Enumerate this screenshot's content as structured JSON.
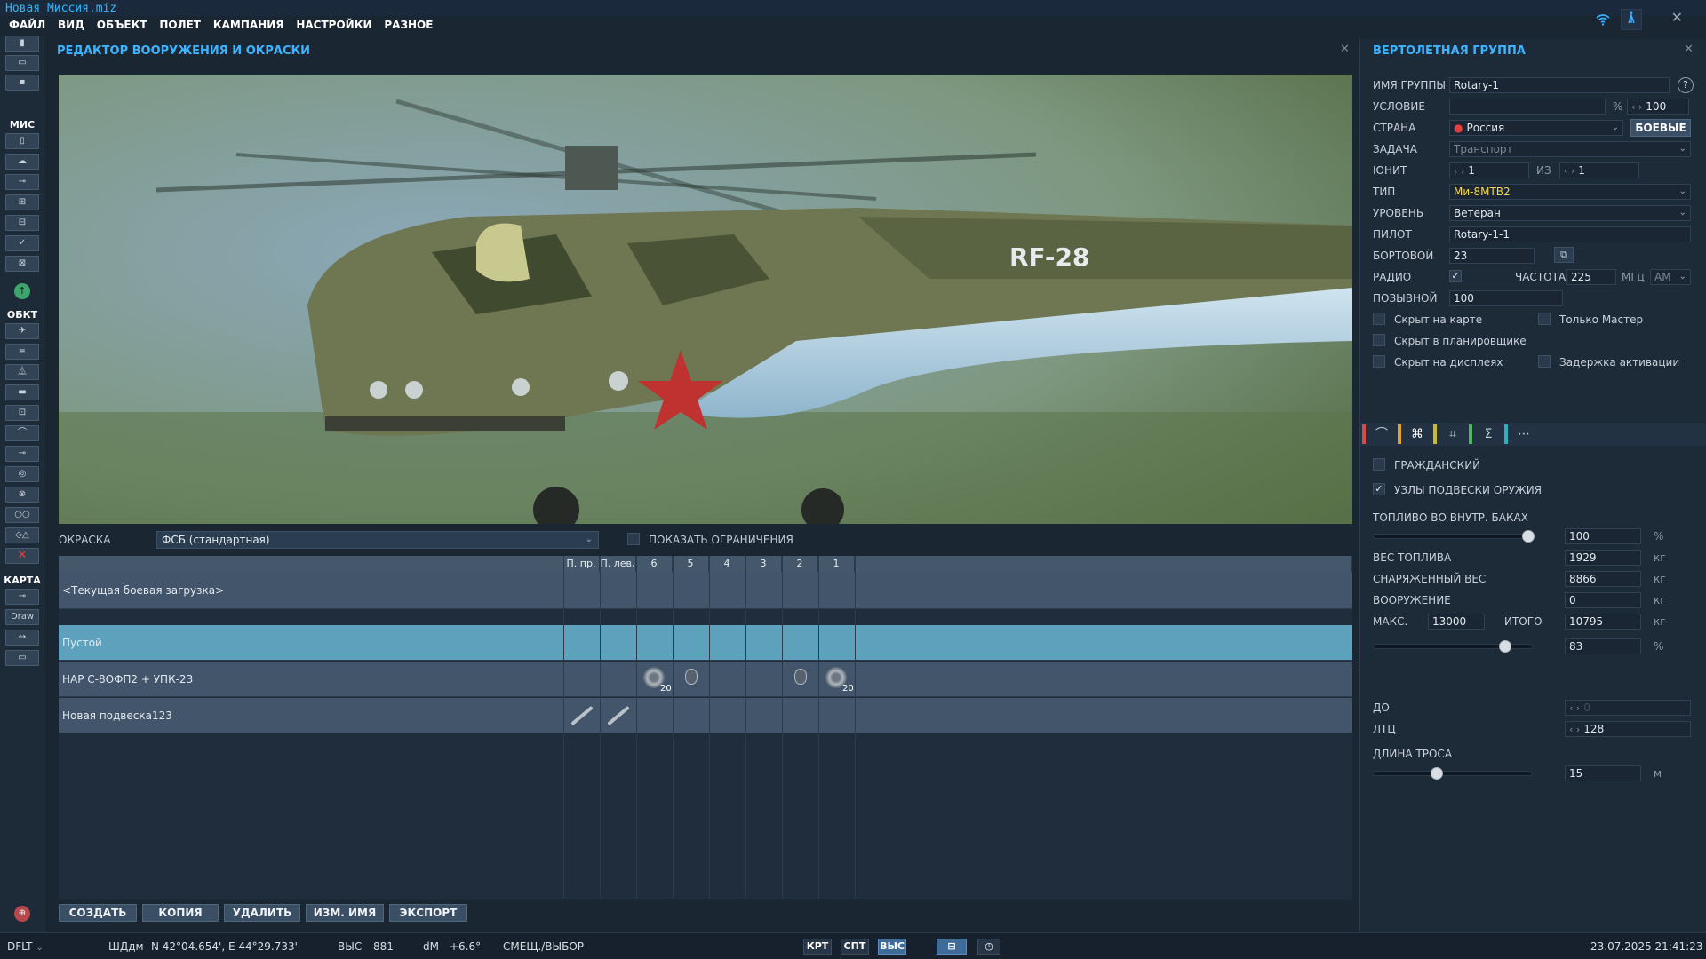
{
  "window": {
    "title": "Новая Миссия.miz"
  },
  "menu": [
    "ФАЙЛ",
    "ВИД",
    "ОБЪЕКТ",
    "ПОЛЕТ",
    "КАМПАНИЯ",
    "НАСТРОЙКИ",
    "РАЗНОЕ"
  ],
  "toolbar": {
    "section_mis": "МИС",
    "section_obj": "ОБКТ",
    "section_map": "КАРТА",
    "draw_label": "Draw"
  },
  "editor": {
    "title": "РЕДАКТОР ВООРУЖЕНИЯ И ОКРАСКИ",
    "skin_label": "ОКРАСКА",
    "skin_value": "ФСБ (стандартная)",
    "show_limits_label": "ПОКАЗАТЬ ОГРАНИЧЕНИЯ",
    "aircraft_marking": "RF-28",
    "columns": [
      "П. пр.",
      "П. лев.",
      "6",
      "5",
      "4",
      "3",
      "2",
      "1"
    ],
    "current_loadout": "<Текущая боевая загрузка>",
    "rows": [
      {
        "name": "Пустой"
      },
      {
        "name": "НАР С-8ОФП2 + УПК-23",
        "count_a": "20",
        "count_b": "20"
      },
      {
        "name": "Новая подвеска123"
      }
    ],
    "buttons": [
      "СОЗДАТЬ",
      "КОПИЯ",
      "УДАЛИТЬ",
      "ИЗМ. ИМЯ",
      "ЭКСПОРТ"
    ]
  },
  "group": {
    "title": "ВЕРТОЛЕТНАЯ ГРУППА",
    "name_label": "ИМЯ ГРУППЫ",
    "name_value": "Rotary-1",
    "condition_label": "УСЛОВИЕ",
    "percent_sign": "%",
    "condition_prob": "100",
    "country_label": "СТРАНА",
    "country_value": "Россия",
    "combat_button": "БОЕВЫЕ",
    "task_label": "ЗАДАЧА",
    "task_value": "Транспорт",
    "unit_label": "ЮНИТ",
    "unit_value": "1",
    "of_label": "ИЗ",
    "unit_total": "1",
    "type_label": "ТИП",
    "type_value": "Ми-8МТВ2",
    "level_label": "УРОВЕНЬ",
    "level_value": "Ветеран",
    "pilot_label": "ПИЛОТ",
    "pilot_value": "Rotary-1-1",
    "board_label": "БОРТОВОЙ",
    "board_value": "23",
    "radio_label": "РАДИО",
    "freq_label": "ЧАСТОТА",
    "freq_value": "225",
    "freq_unit": "МГц",
    "modulation": "AM",
    "callsign_label": "ПОЗЫВНОЙ",
    "callsign_value": "100",
    "check_hidden_map": "Скрыт на карте",
    "check_master_only": "Только Мастер",
    "check_hidden_planner": "Скрыт в планировщике",
    "check_hidden_displays": "Скрыт на дисплеях",
    "check_late_activation": "Задержка активации"
  },
  "payload": {
    "civilian_label": "ГРАЖДАНСКИЙ",
    "pylons_label": "УЗЛЫ ПОДВЕСКИ ОРУЖИЯ",
    "fuel_internal_label": "ТОПЛИВО ВО ВНУТР. БАКАХ",
    "fuel_internal_value": "100",
    "pct": "%",
    "fuel_weight_label": "ВЕС ТОПЛИВА",
    "fuel_weight_value": "1929",
    "empty_weight_label": "СНАРЯЖЕННЫЙ ВЕС",
    "empty_weight_value": "8866",
    "weapons_label": "ВООРУЖЕНИЕ",
    "weapons_value": "0",
    "max_label": "МАКС.",
    "max_value": "13000",
    "total_label": "ИТОГО",
    "total_value": "10795",
    "kg": "кг",
    "load_pct_value": "83",
    "do_label": "ДО",
    "do_value": "0",
    "ltc_label": "ЛТЦ",
    "ltc_value": "128",
    "cable_label": "ДЛИНА ТРОСА",
    "cable_value": "15",
    "cable_unit": "м",
    "fuel_level": 0.98,
    "load_level": 0.83,
    "cable_level": 0.4
  },
  "status": {
    "profile": "DFLT",
    "coord_mode": "ШДдм",
    "coords": "N 42°04.654', E 44°29.733'",
    "alt_label": "ВЫС",
    "alt_value": "881",
    "dm_label": "dM",
    "dm_value": "+6.6°",
    "mode": "СМЕЩ./ВЫБОР",
    "btn_krt": "КРТ",
    "btn_spt": "СПТ",
    "btn_vys": "ВЫС",
    "datetime": "23.07.2025 21:41:23"
  },
  "colors": {
    "accent": "#3cb4ff",
    "type_yellow": "#f6d84a",
    "selected_row": "#5ea1bd"
  }
}
